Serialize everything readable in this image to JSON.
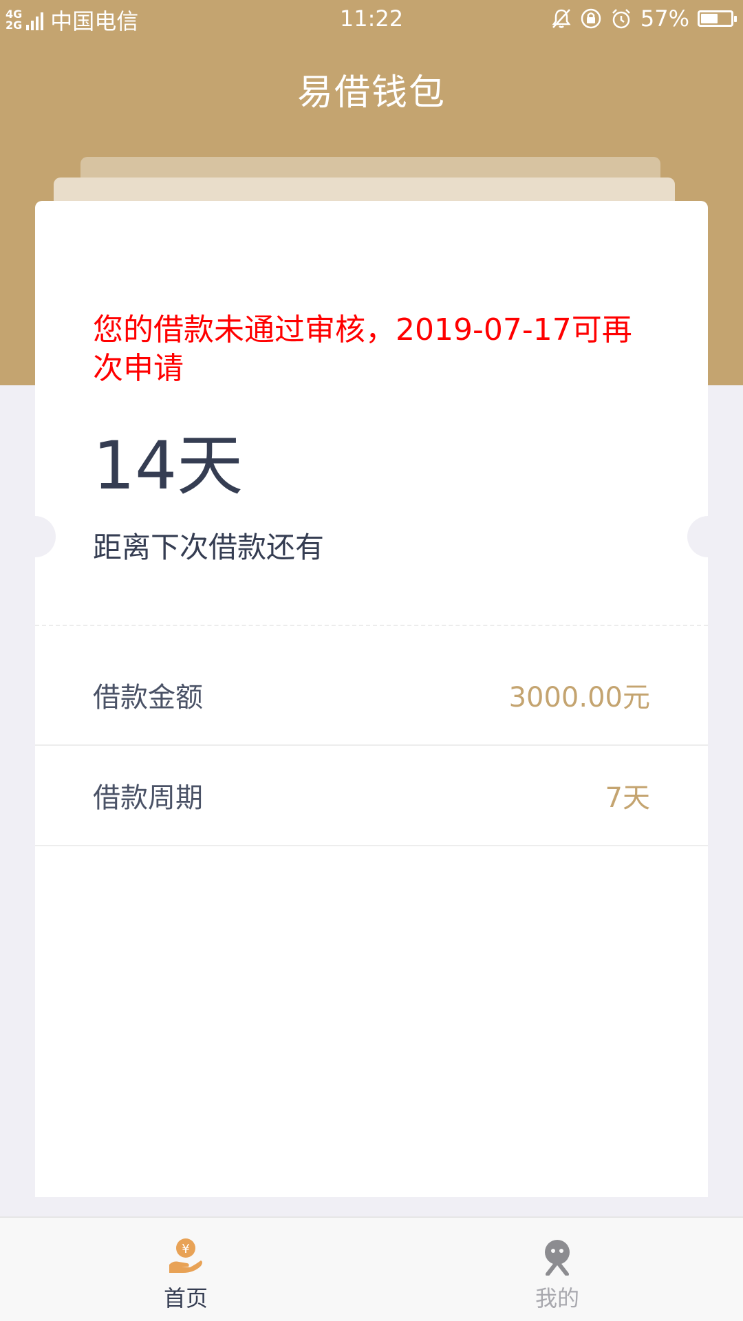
{
  "status_bar": {
    "network_top": "4G",
    "network_bottom": "2G",
    "carrier": "中国电信",
    "time": "11:22",
    "battery_percent": "57%",
    "battery_level": 0.57
  },
  "header": {
    "title": "易借钱包"
  },
  "card": {
    "reject_message": "您的借款未通过审核，2019-07-17可再次申请",
    "days_value": "14天",
    "days_label": "距离下次借款还有",
    "rows": [
      {
        "label": "借款金额",
        "value": "3000.00元"
      },
      {
        "label": "借款周期",
        "value": "7天"
      }
    ]
  },
  "tab_bar": {
    "tabs": [
      {
        "label": "首页",
        "icon": "hand-yen-icon",
        "active": true
      },
      {
        "label": "我的",
        "icon": "person-icon",
        "active": false
      }
    ]
  },
  "colors": {
    "brand": "#c4a470",
    "alert": "#ff0000",
    "text_dark": "#353d52"
  }
}
